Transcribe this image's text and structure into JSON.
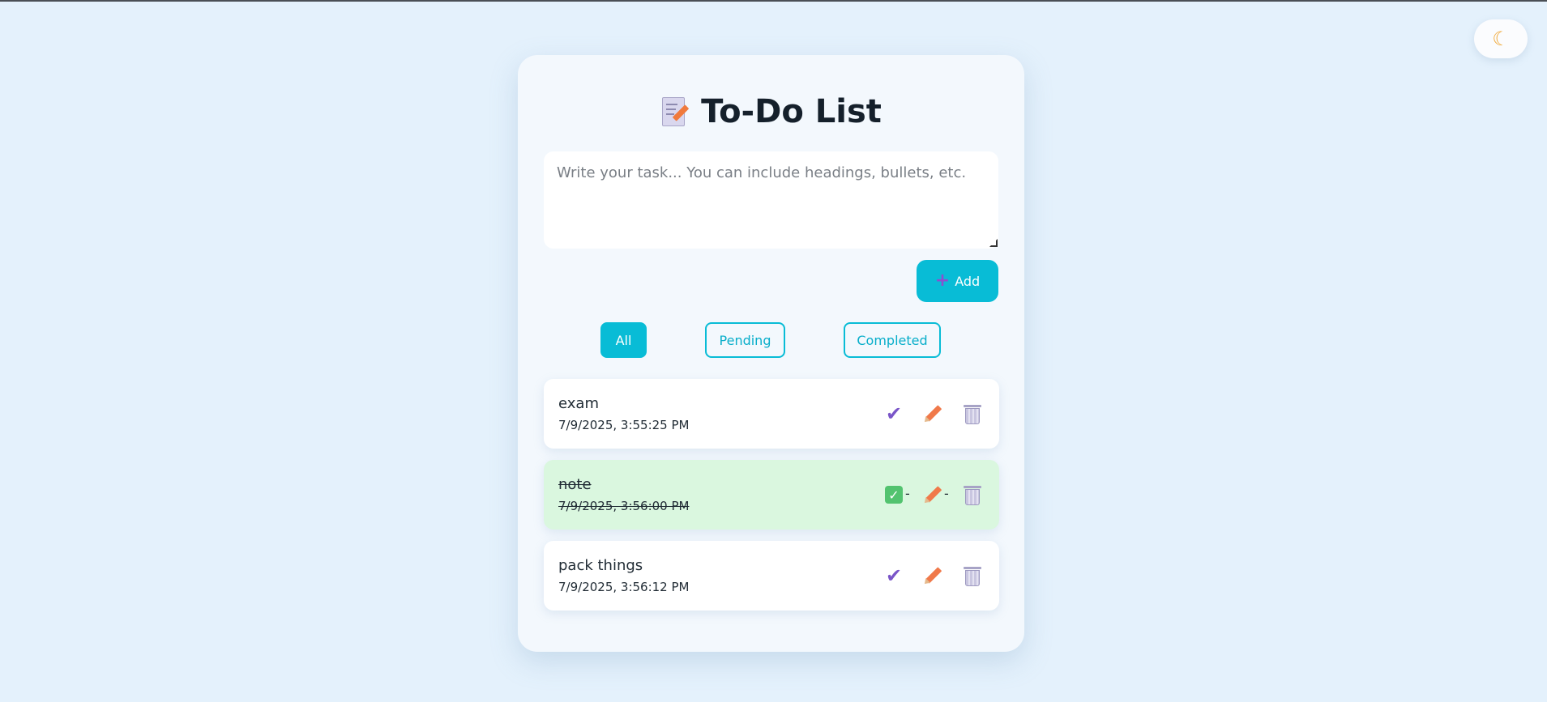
{
  "app": {
    "title": "To-Do List",
    "theme_toggle_icon": "moon-icon",
    "title_icon": "memo-icon"
  },
  "input": {
    "placeholder": "Write your task... You can include headings, bullets, etc.",
    "value": ""
  },
  "add_button": {
    "label": "Add",
    "icon": "plus-icon"
  },
  "filters": [
    {
      "label": "All",
      "active": true
    },
    {
      "label": "Pending",
      "active": false
    },
    {
      "label": "Completed",
      "active": false
    }
  ],
  "tasks": [
    {
      "text": "exam",
      "time": "7/9/2025, 3:55:25 PM",
      "completed": false
    },
    {
      "text": "note",
      "time": "7/9/2025, 3:56:00 PM",
      "completed": true
    },
    {
      "text": "pack things",
      "time": "7/9/2025, 3:56:12 PM",
      "completed": false
    }
  ],
  "colors": {
    "accent": "#08bcd6",
    "background": "#e4f1fc",
    "completed_bg": "#daf7df",
    "check": "#7a55c8"
  }
}
